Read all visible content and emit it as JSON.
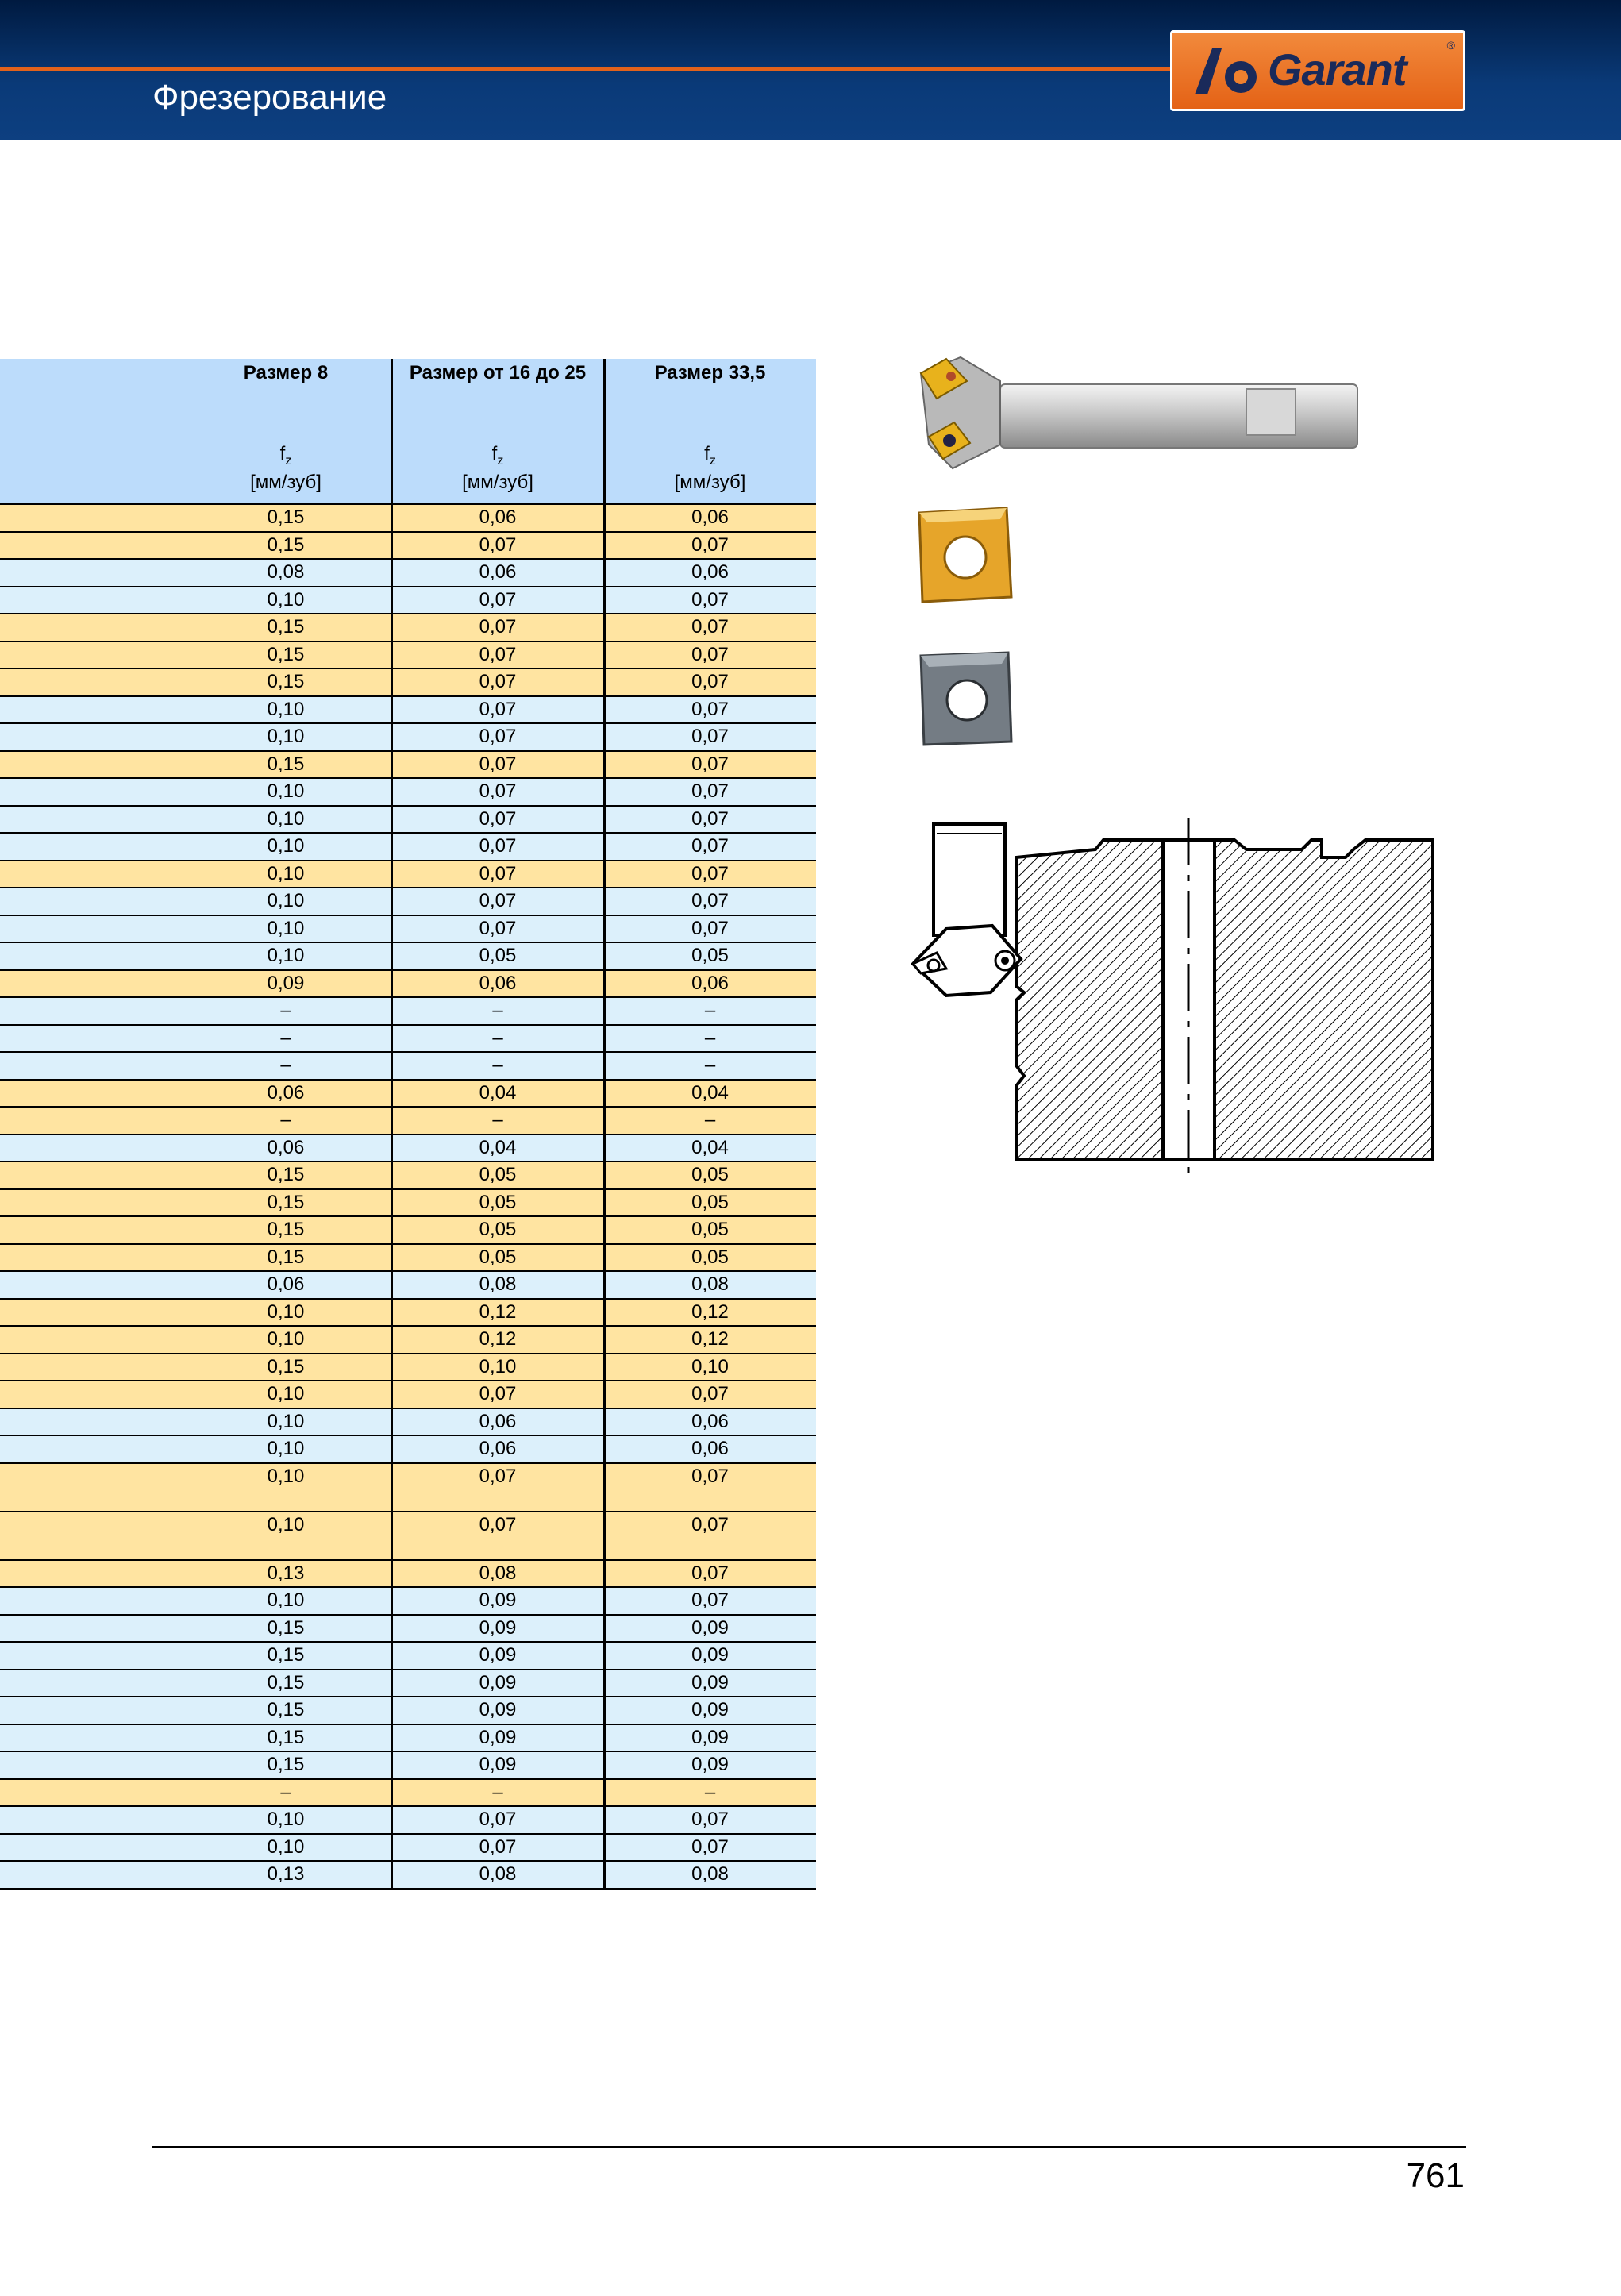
{
  "header": {
    "section_title": "Фрезерование",
    "logo_text": "Garant",
    "logo_reg": "®"
  },
  "table": {
    "columns": [
      {
        "size": "Размер 8",
        "fz": "f",
        "fz_sub": "z",
        "unit": "[мм/зуб]"
      },
      {
        "size": "Размер  от 16 до 25",
        "fz": "f",
        "fz_sub": "z",
        "unit": "[мм/зуб]"
      },
      {
        "size": "Размер 33,5",
        "fz": "f",
        "fz_sub": "z",
        "unit": "[мм/зуб]"
      }
    ],
    "rows": [
      {
        "c": "y",
        "v": [
          "0,15",
          "0,06",
          "0,06"
        ]
      },
      {
        "c": "y",
        "v": [
          "0,15",
          "0,07",
          "0,07"
        ]
      },
      {
        "c": "b",
        "v": [
          "0,08",
          "0,06",
          "0,06"
        ]
      },
      {
        "c": "b",
        "v": [
          "0,10",
          "0,07",
          "0,07"
        ]
      },
      {
        "c": "y",
        "v": [
          "0,15",
          "0,07",
          "0,07"
        ]
      },
      {
        "c": "y",
        "v": [
          "0,15",
          "0,07",
          "0,07"
        ]
      },
      {
        "c": "y",
        "v": [
          "0,15",
          "0,07",
          "0,07"
        ]
      },
      {
        "c": "b",
        "v": [
          "0,10",
          "0,07",
          "0,07"
        ]
      },
      {
        "c": "b",
        "v": [
          "0,10",
          "0,07",
          "0,07"
        ]
      },
      {
        "c": "y",
        "v": [
          "0,15",
          "0,07",
          "0,07"
        ]
      },
      {
        "c": "b",
        "v": [
          "0,10",
          "0,07",
          "0,07"
        ]
      },
      {
        "c": "b",
        "v": [
          "0,10",
          "0,07",
          "0,07"
        ]
      },
      {
        "c": "b",
        "v": [
          "0,10",
          "0,07",
          "0,07"
        ]
      },
      {
        "c": "y",
        "v": [
          "0,10",
          "0,07",
          "0,07"
        ]
      },
      {
        "c": "b",
        "v": [
          "0,10",
          "0,07",
          "0,07"
        ]
      },
      {
        "c": "b",
        "v": [
          "0,10",
          "0,07",
          "0,07"
        ]
      },
      {
        "c": "b",
        "v": [
          "0,10",
          "0,05",
          "0,05"
        ]
      },
      {
        "c": "y",
        "v": [
          "0,09",
          "0,06",
          "0,06"
        ]
      },
      {
        "c": "b",
        "v": [
          "–",
          "–",
          "–"
        ]
      },
      {
        "c": "b",
        "v": [
          "–",
          "–",
          "–"
        ]
      },
      {
        "c": "b",
        "v": [
          "–",
          "–",
          "–"
        ]
      },
      {
        "c": "y",
        "v": [
          "0,06",
          "0,04",
          "0,04"
        ]
      },
      {
        "c": "y",
        "v": [
          "–",
          "–",
          "–"
        ]
      },
      {
        "c": "b",
        "v": [
          "0,06",
          "0,04",
          "0,04"
        ]
      },
      {
        "c": "y",
        "v": [
          "0,15",
          "0,05",
          "0,05"
        ]
      },
      {
        "c": "y",
        "v": [
          "0,15",
          "0,05",
          "0,05"
        ]
      },
      {
        "c": "y",
        "v": [
          "0,15",
          "0,05",
          "0,05"
        ]
      },
      {
        "c": "y",
        "v": [
          "0,15",
          "0,05",
          "0,05"
        ]
      },
      {
        "c": "b",
        "v": [
          "0,06",
          "0,08",
          "0,08"
        ]
      },
      {
        "c": "y",
        "v": [
          "0,10",
          "0,12",
          "0,12"
        ]
      },
      {
        "c": "y",
        "v": [
          "0,10",
          "0,12",
          "0,12"
        ]
      },
      {
        "c": "y",
        "v": [
          "0,15",
          "0,10",
          "0,10"
        ]
      },
      {
        "c": "y",
        "v": [
          "0,10",
          "0,07",
          "0,07"
        ]
      },
      {
        "c": "b",
        "v": [
          "0,10",
          "0,06",
          "0,06"
        ]
      },
      {
        "c": "b",
        "v": [
          "0,10",
          "0,06",
          "0,06"
        ]
      },
      {
        "c": "y",
        "v": [
          "0,10",
          "0,07",
          "0,07"
        ],
        "tall": true
      },
      {
        "c": "y",
        "v": [
          "0,10",
          "0,07",
          "0,07"
        ],
        "tall": true
      },
      {
        "c": "y",
        "v": [
          "0,13",
          "0,08",
          "0,07"
        ]
      },
      {
        "c": "b",
        "v": [
          "0,10",
          "0,09",
          "0,07"
        ]
      },
      {
        "c": "b",
        "v": [
          "0,15",
          "0,09",
          "0,09"
        ]
      },
      {
        "c": "b",
        "v": [
          "0,15",
          "0,09",
          "0,09"
        ]
      },
      {
        "c": "b",
        "v": [
          "0,15",
          "0,09",
          "0,09"
        ]
      },
      {
        "c": "b",
        "v": [
          "0,15",
          "0,09",
          "0,09"
        ]
      },
      {
        "c": "b",
        "v": [
          "0,15",
          "0,09",
          "0,09"
        ]
      },
      {
        "c": "b",
        "v": [
          "0,15",
          "0,09",
          "0,09"
        ]
      },
      {
        "c": "y",
        "v": [
          "–",
          "–",
          "–"
        ]
      },
      {
        "c": "b",
        "v": [
          "0,10",
          "0,07",
          "0,07"
        ]
      },
      {
        "c": "b",
        "v": [
          "0,10",
          "0,07",
          "0,07"
        ]
      },
      {
        "c": "b",
        "v": [
          "0,13",
          "0,08",
          "0,08"
        ]
      }
    ]
  },
  "colors": {
    "row_yellow": "#ffe4a1",
    "row_blue": "#dcf0fb",
    "header_blue": "#bcdcfb",
    "accent_orange": "#e2621b",
    "banner_navy": "#0a3a78"
  },
  "footer": {
    "page_number": "761"
  }
}
